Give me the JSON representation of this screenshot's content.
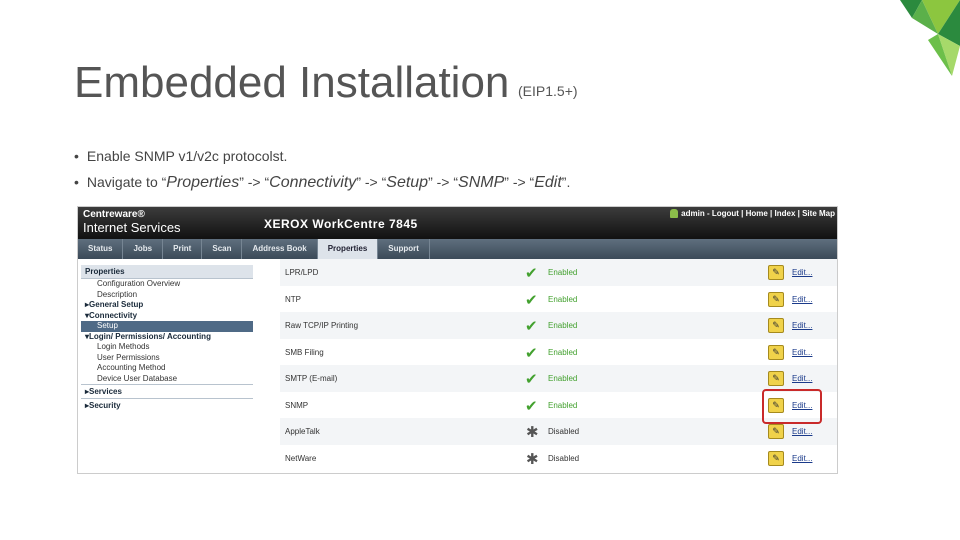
{
  "slide": {
    "title": "Embedded Installation",
    "subtitle": "(EIP1.5+)",
    "bullets": [
      {
        "dot": "•",
        "text": "Enable SNMP v1/v2c protocolst."
      },
      {
        "dot": "•",
        "pre": "Navigate to “",
        "p1": "Properties",
        "s1": "” -> “",
        "p2": "Connectivity",
        "s2": "” -> “",
        "p3": "Setup",
        "s3": "” -> “",
        "p4": "SNMP",
        "s4": "” -> “",
        "p5": "Edit",
        "s5": "”."
      }
    ],
    "colors": {
      "green1": "#2b8a3e",
      "green2": "#8cc63f",
      "green3": "#a6d96a"
    }
  },
  "screenshot": {
    "brand1": "Centreware®",
    "brand2": "Internet Services",
    "model": "XEROX WorkCentre 7845",
    "toplinks": "admin - Logout | Home | Index | Site Map",
    "tabs": [
      "Status",
      "Jobs",
      "Print",
      "Scan",
      "Address Book",
      "Properties",
      "Support"
    ],
    "active_tab": "Properties",
    "sidebar": [
      {
        "label": "Properties",
        "cls": "lvl1 head"
      },
      {
        "label": "Configuration Overview",
        "cls": "lvl3"
      },
      {
        "label": "Description",
        "cls": "lvl3"
      },
      {
        "label": "▸General Setup",
        "cls": "lvl1"
      },
      {
        "label": "▾Connectivity",
        "cls": "lvl1"
      },
      {
        "label": "Setup",
        "cls": "lvl3 sel"
      },
      {
        "label": "▾Login/ Permissions/ Accounting",
        "cls": "lvl1"
      },
      {
        "label": "Login Methods",
        "cls": "lvl3"
      },
      {
        "label": "User Permissions",
        "cls": "lvl3"
      },
      {
        "label": "Accounting Method",
        "cls": "lvl3"
      },
      {
        "label": "Device User Database",
        "cls": "lvl3"
      },
      {
        "label": "▸Services",
        "cls": "lvl1 sep"
      },
      {
        "label": "▸Security",
        "cls": "lvl1 sep"
      }
    ],
    "protocols": [
      {
        "name": "LPR/LPD",
        "status": "Enabled",
        "enabled": true,
        "edit": "Edit..."
      },
      {
        "name": "NTP",
        "status": "Enabled",
        "enabled": true,
        "edit": "Edit..."
      },
      {
        "name": "Raw TCP/IP Printing",
        "status": "Enabled",
        "enabled": true,
        "edit": "Edit..."
      },
      {
        "name": "SMB Filing",
        "status": "Enabled",
        "enabled": true,
        "edit": "Edit..."
      },
      {
        "name": "SMTP (E-mail)",
        "status": "Enabled",
        "enabled": true,
        "edit": "Edit..."
      },
      {
        "name": "SNMP",
        "status": "Enabled",
        "enabled": true,
        "edit": "Edit..."
      },
      {
        "name": "AppleTalk",
        "status": "Disabled",
        "enabled": false,
        "edit": "Edit..."
      },
      {
        "name": "NetWare",
        "status": "Disabled",
        "enabled": false,
        "edit": "Edit..."
      }
    ]
  }
}
